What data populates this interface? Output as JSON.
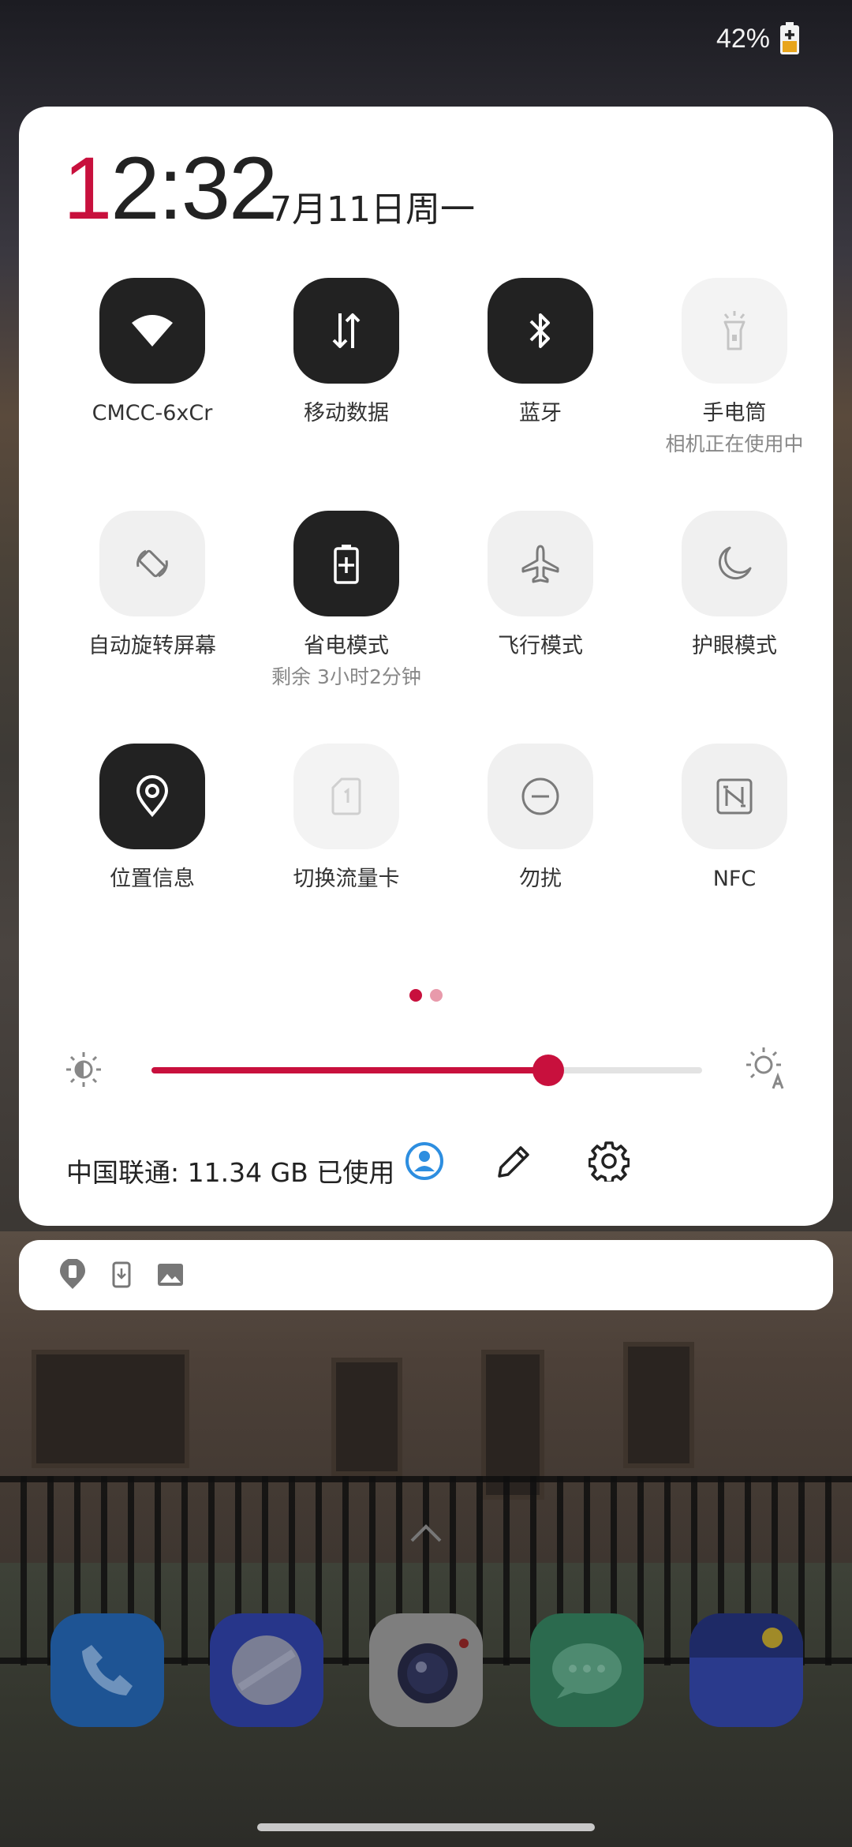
{
  "status_bar": {
    "battery_percent": "42%",
    "battery_icon": "battery-charging-icon"
  },
  "panel": {
    "clock_first": "1",
    "clock_rest": "2:32",
    "date": "7月11日周一",
    "tiles": [
      {
        "label": "CMCC-6xCr",
        "sub": "",
        "state": "on",
        "icon": "wifi-icon"
      },
      {
        "label": "移动数据",
        "sub": "",
        "state": "on",
        "icon": "mobile-data-icon"
      },
      {
        "label": "蓝牙",
        "sub": "",
        "state": "on",
        "icon": "bluetooth-icon"
      },
      {
        "label": "手电筒",
        "sub": "相机正在使用中",
        "state": "disabled",
        "icon": "flashlight-icon"
      },
      {
        "label": "自动旋转屏幕",
        "sub": "",
        "state": "off",
        "icon": "auto-rotate-icon"
      },
      {
        "label": "省电模式",
        "sub": "剩余 3小时2分钟",
        "state": "on",
        "icon": "battery-saver-icon"
      },
      {
        "label": "飞行模式",
        "sub": "",
        "state": "off",
        "icon": "airplane-icon"
      },
      {
        "label": "护眼模式",
        "sub": "",
        "state": "off",
        "icon": "moon-icon"
      },
      {
        "label": "位置信息",
        "sub": "",
        "state": "on",
        "icon": "location-icon"
      },
      {
        "label": "切换流量卡",
        "sub": "",
        "state": "disabled",
        "icon": "sim-card-icon"
      },
      {
        "label": "勿扰",
        "sub": "",
        "state": "off",
        "icon": "do-not-disturb-icon"
      },
      {
        "label": "NFC",
        "sub": "",
        "state": "off",
        "icon": "nfc-icon"
      }
    ],
    "page_indicator": {
      "current": 1,
      "total": 2
    },
    "brightness": {
      "level": 0.72,
      "auto_icon": "auto-brightness-icon",
      "low_icon": "brightness-icon"
    },
    "data_usage": "中国联通: 11.34 GB 已使用",
    "actions": [
      "user-icon",
      "edit-icon",
      "settings-icon"
    ]
  },
  "notifications": {
    "icons": [
      "location-notification-icon",
      "download-icon",
      "image-icon"
    ]
  },
  "dock": {
    "apps": [
      "phone-app",
      "browser-app",
      "camera-app",
      "messages-app",
      "wallet-app"
    ]
  },
  "colors": {
    "accent": "#c8103d",
    "tile_on": "#222222",
    "tile_off": "#f0f0f0",
    "user_blue": "#2d8ee0"
  }
}
